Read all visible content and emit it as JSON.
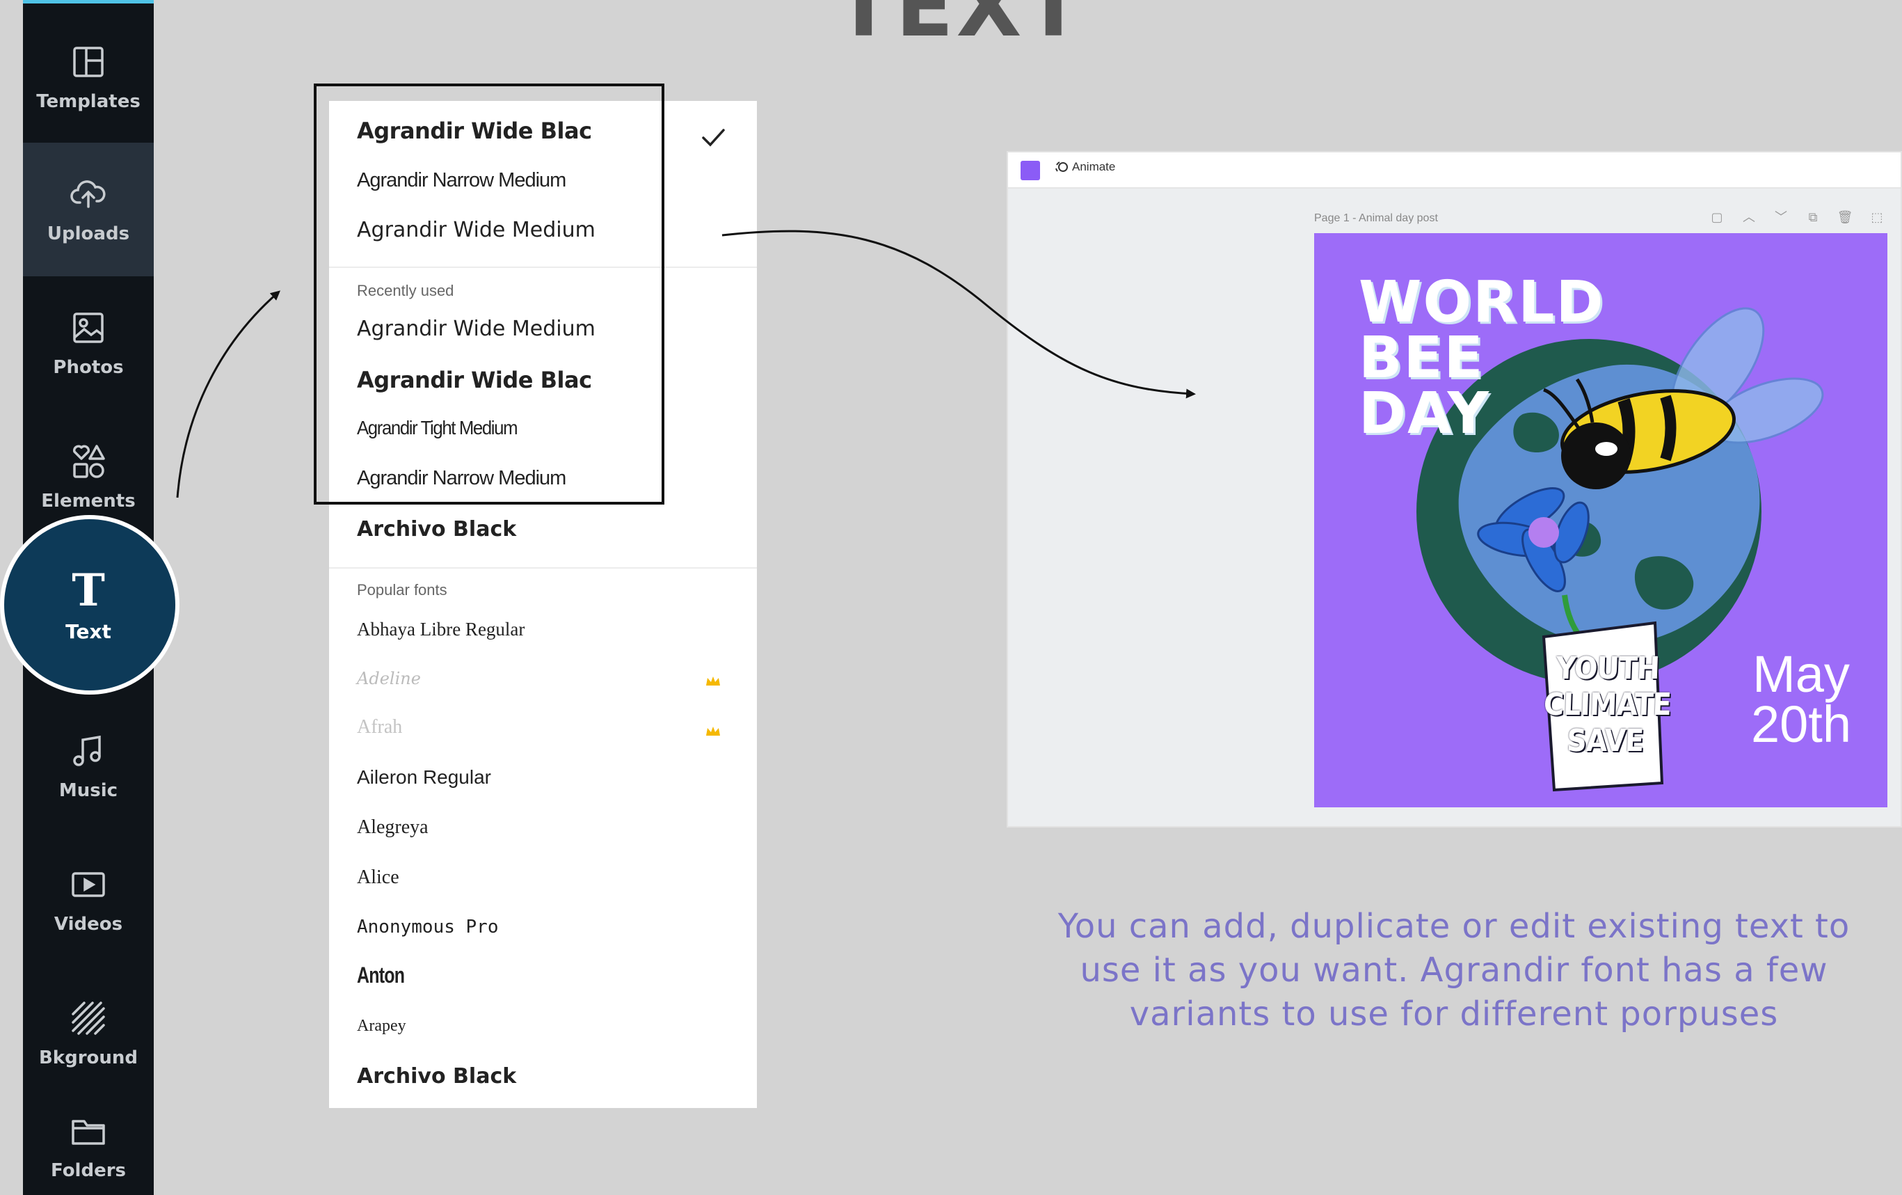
{
  "page": {
    "title": "TEXT"
  },
  "sidebar": {
    "items": [
      {
        "label": "Templates",
        "icon": "templates-icon"
      },
      {
        "label": "Uploads",
        "icon": "cloud-upload-icon"
      },
      {
        "label": "Photos",
        "icon": "image-icon"
      },
      {
        "label": "Elements",
        "icon": "shapes-icon"
      },
      {
        "label": "Text",
        "icon": "text-t-icon"
      },
      {
        "label": "Music",
        "icon": "music-note-icon"
      },
      {
        "label": "Videos",
        "icon": "video-play-icon"
      },
      {
        "label": "Bkground",
        "icon": "background-stripes-icon"
      },
      {
        "label": "Folders",
        "icon": "folder-icon"
      }
    ],
    "active": "Text"
  },
  "font_panel": {
    "selected": "Agrandir Wide Blac",
    "top_fonts": [
      "Agrandir Wide Blac",
      "Agrandir Narrow Medium",
      "Agrandir Wide Medium"
    ],
    "recently_used_label": "Recently used",
    "recently_used": [
      "Agrandir Wide Medium",
      "Agrandir Wide Blac",
      "Agrandir Tight Medium",
      "Agrandir Narrow Medium",
      "Archivo Black"
    ],
    "popular_label": "Popular fonts",
    "popular": [
      "Abhaya Libre Regular",
      "Adeline",
      "Afrah",
      "Aileron Regular",
      "Alegreya",
      "Alice",
      "Anonymous Pro",
      "Anton",
      "Arapey",
      "Archivo Black"
    ],
    "premium_fonts": [
      "Adeline",
      "Afrah"
    ],
    "colors": {
      "premium_crown": "#f5b800"
    }
  },
  "preview": {
    "toolbar": {
      "animate_label": "Animate",
      "swatch_color": "#8b5cf6"
    },
    "page_label": "Page 1 - Animal day post",
    "design": {
      "headline": [
        "WORLD",
        "BEE",
        "DAY"
      ],
      "sign": [
        "YOUTH",
        "CLIMATE",
        "SAVE"
      ],
      "date": [
        "May",
        "20th"
      ],
      "background_color": "#9d6cf8"
    }
  },
  "description": "You can add, duplicate or edit existing text to use it as you want. Agrandir font has a few variants to use for different porpuses"
}
